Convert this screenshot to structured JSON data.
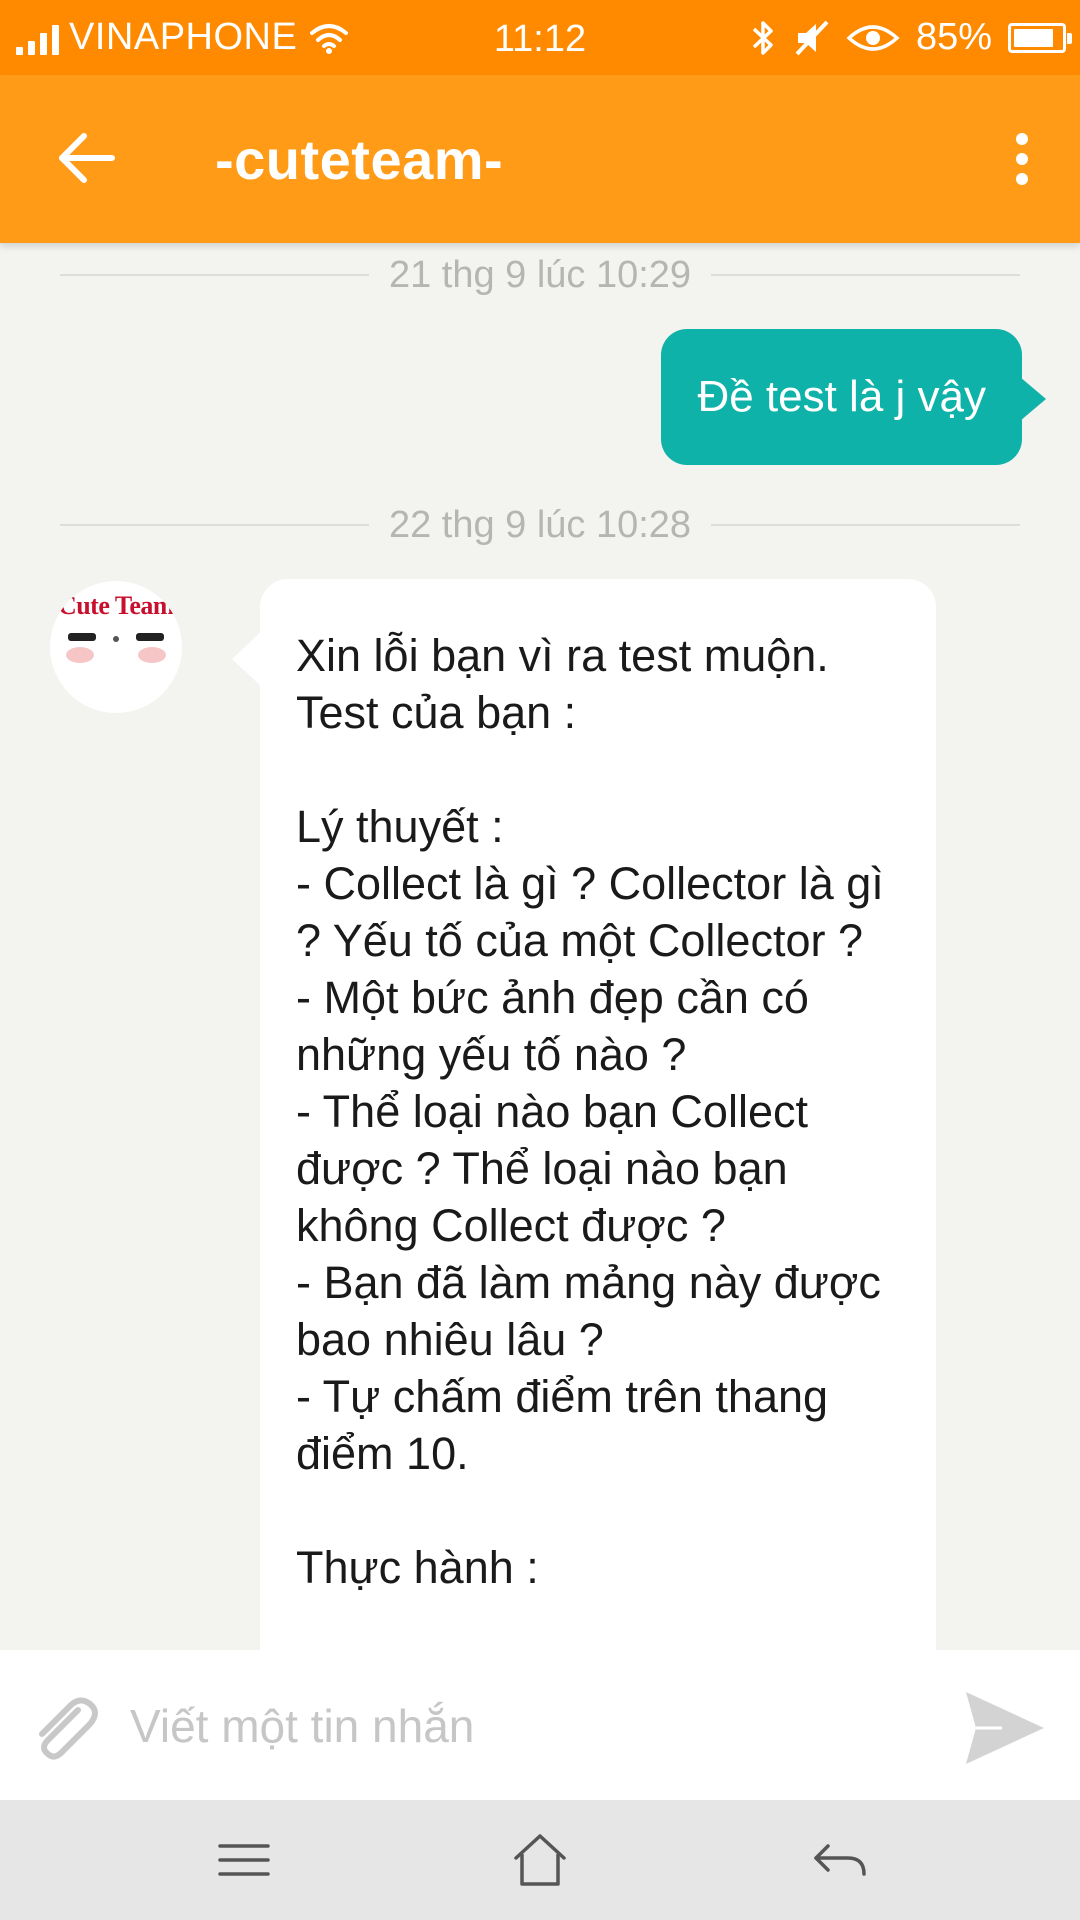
{
  "status_bar": {
    "carrier": "VINAPHONE",
    "time": "11:12",
    "battery": "85%",
    "battery_level": 0.85,
    "icons": [
      "signal-icon",
      "wifi-icon",
      "bluetooth-icon",
      "mute-icon",
      "eye-icon",
      "battery-icon"
    ]
  },
  "header": {
    "title": "-cuteteam-",
    "back_icon": "arrow-left-icon",
    "menu_icon": "more-vertical-icon"
  },
  "messages": {
    "date_1": "21 thg 9 lúc 10:29",
    "outgoing_1": "Đề test là j vậy",
    "date_2": "22 thg 9 lúc 10:28",
    "avatar_text": "Cute Team",
    "incoming_1": "Xin lỗi bạn vì ra test muộn.\nTest của bạn :\n\nLý thuyết :\n- Collect là gì ? Collector là gì ? Yếu tố của một Collector ?\n- Một bức ảnh đẹp cần có những yếu tố nào ?\n- Thể loại nào bạn Collect được ? Thể loại nào bạn không Collect được ?\n- Bạn đã làm mảng này được bao nhiêu lâu ?\n- Tự chấm điểm trên thang điểm 10.\n\nThực hành :"
  },
  "composer": {
    "placeholder": "Viết một tin nhắn",
    "value": "",
    "attach_icon": "paperclip-icon",
    "send_icon": "send-icon"
  },
  "nav": {
    "icons": [
      "menu-icon",
      "home-icon",
      "back-icon"
    ]
  },
  "colors": {
    "status_bar": "#ff8a00",
    "app_bar": "#ff9b17",
    "outgoing_bubble": "#0fb2a8",
    "background": "#f3f3ef"
  }
}
